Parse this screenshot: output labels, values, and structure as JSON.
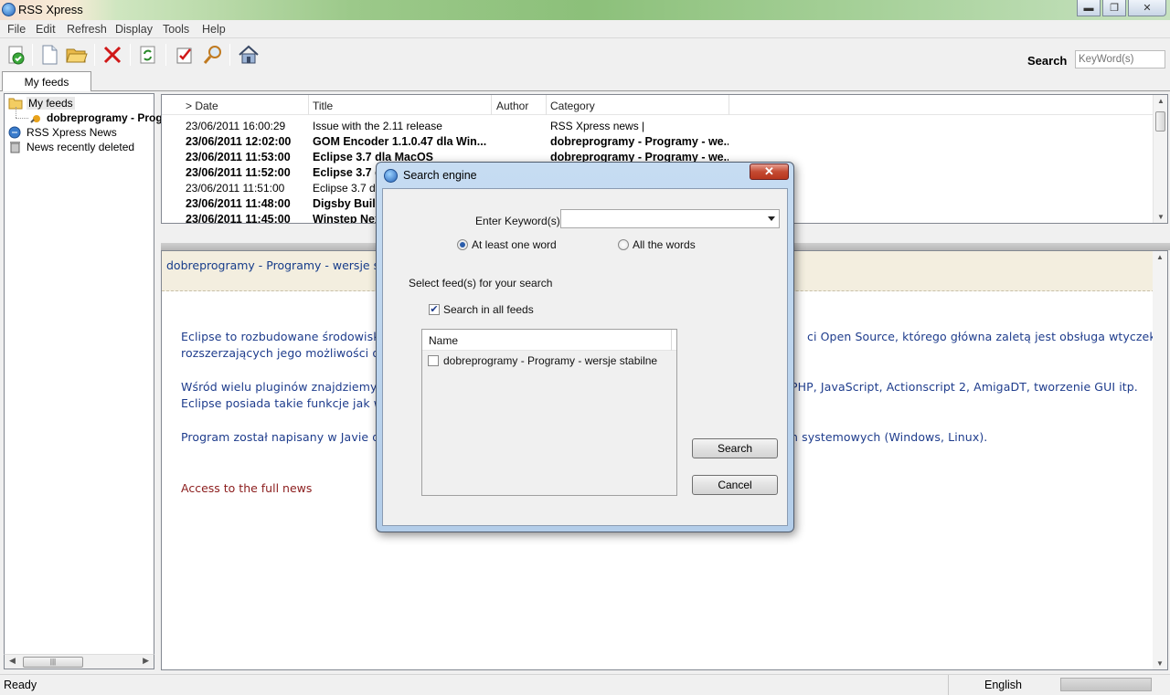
{
  "app": {
    "title": "RSS Xpress"
  },
  "menu": [
    "File",
    "Edit",
    "Refresh",
    "Display",
    "Tools",
    "Help"
  ],
  "toolbar": {
    "buttons": [
      "check-feeds-icon",
      "new-document-icon",
      "open-folder-icon",
      "delete-icon",
      "refresh-icon",
      "mark-read-icon",
      "find-icon",
      "home-icon"
    ],
    "search_label": "Search",
    "search_placeholder": "KeyWord(s)"
  },
  "tabs": {
    "my_feeds": "My feeds"
  },
  "tree": {
    "items": [
      "My feeds",
      "dobreprogramy - Programy - wersje stabilne",
      "RSS Xpress News",
      "News recently deleted"
    ]
  },
  "feed_list": {
    "columns": [
      "> Date",
      "Title",
      "Author",
      "Category"
    ],
    "rows": [
      {
        "date": "23/06/2011 16:00:29",
        "title": "Issue with the 2.11 release",
        "author": "",
        "category": "RSS Xpress news |",
        "bold": false
      },
      {
        "date": "23/06/2011 12:02:00",
        "title": "GOM Encoder 1.1.0.47 dla Win...",
        "author": "",
        "category": "dobreprogramy - Programy - we...",
        "bold": true
      },
      {
        "date": "23/06/2011 11:53:00",
        "title": "Eclipse 3.7 dla MacOS",
        "author": "",
        "category": "dobreprogramy - Programy - we...",
        "bold": true
      },
      {
        "date": "23/06/2011 11:52:00",
        "title": "Eclipse 3.7 d",
        "author": "",
        "category": "",
        "bold": true
      },
      {
        "date": "23/06/2011 11:51:00",
        "title": "Eclipse 3.7 dla",
        "author": "",
        "category": "",
        "bold": false
      },
      {
        "date": "23/06/2011 11:48:00",
        "title": "Digsby  Build",
        "author": "",
        "category": "",
        "bold": true
      },
      {
        "date": "23/06/2011 11:45:00",
        "title": "Winstep Nex",
        "author": "",
        "category": "",
        "bold": true
      }
    ]
  },
  "preview": {
    "title": "dobreprogramy - Programy - wersje stabi",
    "paragraphs": [
      {
        "left": "Eclipse to rozbudowane środowisko p",
        "right": "ci Open Source, którego główna zaletą jest obsługa wtyczek"
      },
      {
        "left": "rozszerzających jego możliwości o ol",
        "right": ""
      },
      {
        "left": "Wśród wielu pluginów znajdziemy m",
        "right": "PHP, JavaScript, Actionscript 2, AmigaDT, tworzenie GUI itp."
      },
      {
        "left": "Eclipse posiada takie funkcje jak we",
        "right": ""
      },
      {
        "left": "Program został napisany w Javie dzi",
        "right": "n systemowych (Windows, Linux)."
      }
    ],
    "access_link": "Access to the full news"
  },
  "status": {
    "text": "Ready",
    "language": "English"
  },
  "dialog": {
    "title": "Search engine",
    "keyword_label": "Enter Keyword(s)",
    "keyword_value": "",
    "radio_one": "At least one word",
    "radio_all": "All the words",
    "radio_selected": "At least one word",
    "select_label": "Select feed(s) for your search",
    "search_all_label": "Search in all feeds",
    "search_all_checked": true,
    "list_header": "Name",
    "feeds": [
      {
        "name": "dobreprogramy - Programy - wersje stabilne",
        "checked": false
      }
    ],
    "search_button": "Search",
    "cancel_button": "Cancel"
  }
}
